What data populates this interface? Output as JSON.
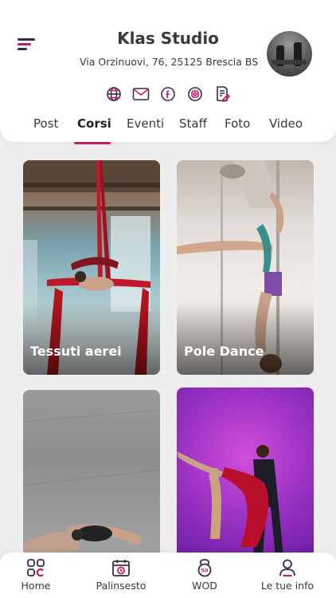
{
  "header": {
    "title": "Klas Studio",
    "address": "Via Orzinuovi, 76, 25125 Brescia BS",
    "social_icons": [
      "globe-icon",
      "mail-icon",
      "facebook-icon",
      "instagram-icon",
      "document-edit-icon"
    ]
  },
  "tabs": [
    {
      "label": "Post"
    },
    {
      "label": "Corsi",
      "active": true
    },
    {
      "label": "Eventi"
    },
    {
      "label": "Staff"
    },
    {
      "label": "Foto"
    },
    {
      "label": "Video"
    }
  ],
  "courses": [
    {
      "label": "Tessuti aerei"
    },
    {
      "label": "Pole Dance"
    },
    {
      "label": ""
    },
    {
      "label": ""
    }
  ],
  "bottom_nav": [
    {
      "label": "Home",
      "icon": "home-grid-icon"
    },
    {
      "label": "Palinsesto",
      "icon": "calendar-icon"
    },
    {
      "label": "WOD",
      "icon": "kettlebell-icon"
    },
    {
      "label": "Le tue info",
      "icon": "user-icon"
    }
  ],
  "colors": {
    "accent": "#c8176e",
    "dark": "#3b2a4a",
    "background": "#efeeef"
  }
}
